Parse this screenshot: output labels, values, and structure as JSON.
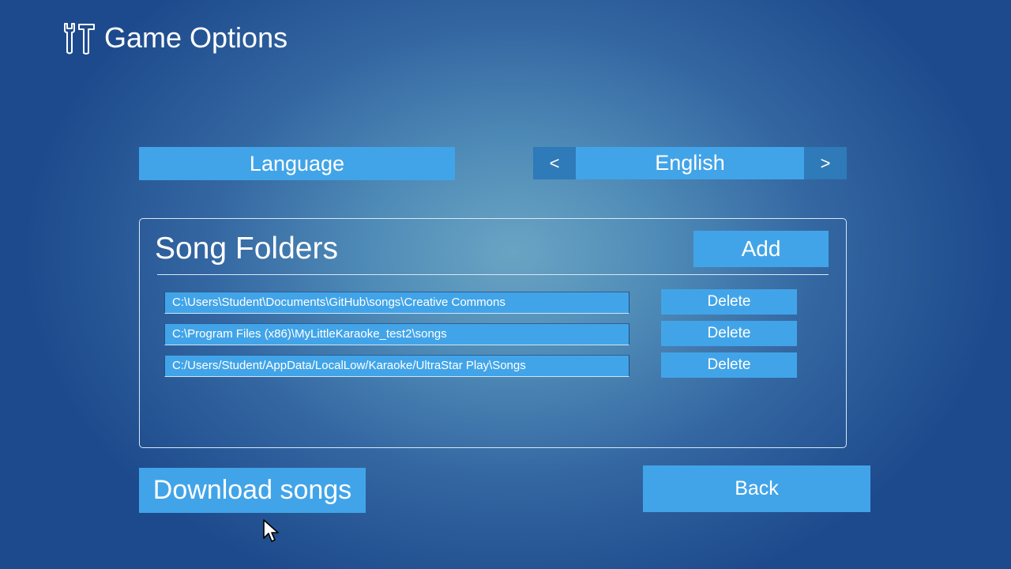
{
  "header": {
    "title": "Game Options",
    "icon": "tools-icon"
  },
  "language": {
    "label": "Language",
    "value": "English",
    "prev_label": "<",
    "next_label": ">"
  },
  "song_folders": {
    "heading": "Song Folders",
    "add_label": "Add",
    "delete_label": "Delete",
    "folders": [
      "C:\\Users\\Student\\Documents\\GitHub\\songs\\Creative Commons",
      "C:\\Program Files (x86)\\MyLittleKaraoke_test2\\songs",
      "C:/Users/Student/AppData/LocalLow/Karaoke/UltraStar Play\\Songs"
    ]
  },
  "footer": {
    "download_label": "Download songs",
    "back_label": "Back"
  },
  "colors": {
    "button": "#42a4e8",
    "arrow_button": "#2f7ab8",
    "background_center": "#6aa4c4",
    "background_edge": "#1d4a8c"
  }
}
